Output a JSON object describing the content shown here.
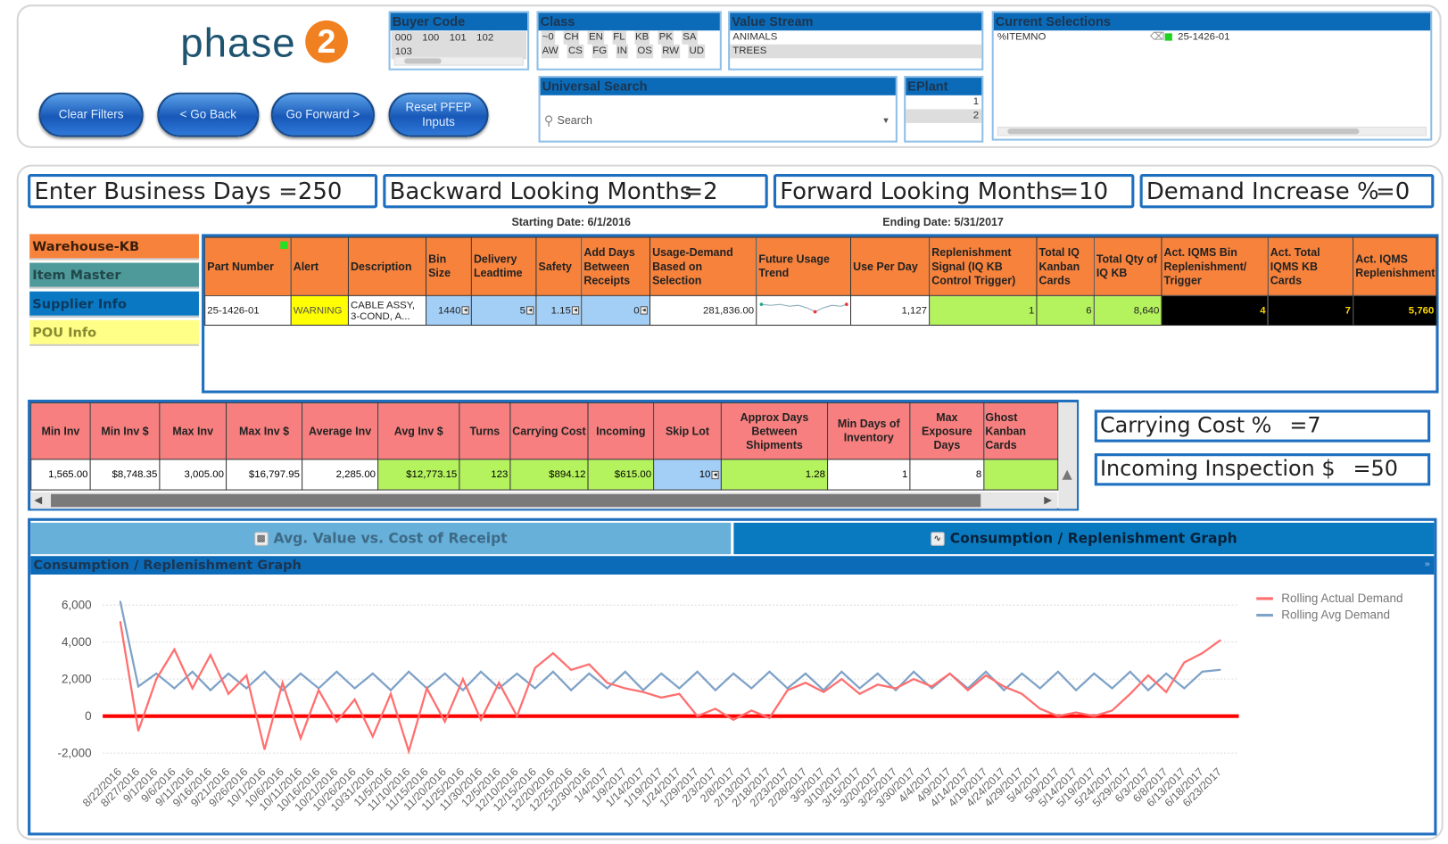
{
  "brand": {
    "logo_text": "phase",
    "logo_badge": "2",
    "accent": "#f08020"
  },
  "buttons": {
    "clear_filters": "Clear Filters",
    "go_back": "< Go Back",
    "go_forward": "Go Forward >",
    "reset_pfep": "Reset PFEP Inputs"
  },
  "filters": {
    "buyer_code": {
      "title": "Buyer Code",
      "values": [
        "000",
        "100",
        "101",
        "102",
        "103"
      ]
    },
    "class": {
      "title": "Class",
      "row1": [
        "~0",
        "CH",
        "EN",
        "FL",
        "KB",
        "PK",
        "SA"
      ],
      "row2": [
        "AW",
        "CS",
        "FG",
        "IN",
        "OS",
        "RW",
        "UD"
      ]
    },
    "value_stream": {
      "title": "Value Stream",
      "values": [
        "ANIMALS",
        "TREES"
      ]
    },
    "universal_search": {
      "title": "Universal Search",
      "placeholder": "Search"
    },
    "eplant": {
      "title": "EPlant",
      "values": [
        "1",
        "2"
      ]
    },
    "current_selections": {
      "title": "Current Selections",
      "field": "%ITEMNO",
      "value": "25-1426-01"
    }
  },
  "inputs": {
    "business_days": {
      "label": "Enter Business Days",
      "value": "=250"
    },
    "backward_months": {
      "label": "Backward Looking Months",
      "value": "=2"
    },
    "forward_months": {
      "label": "Forward Looking Months",
      "value": "=10"
    },
    "demand_increase": {
      "label": "Demand Increase %",
      "value": "=0"
    },
    "carrying_cost": {
      "label": "Carrying Cost %",
      "value": "=7"
    },
    "incoming_inspection": {
      "label": "Incoming Inspection $",
      "value": "=50"
    }
  },
  "dates": {
    "starting": "Starting Date: 6/1/2016",
    "ending": "Ending Date: 5/31/2017"
  },
  "side_tabs": [
    "Warehouse-KB",
    "Item Master",
    "Supplier Info",
    "POU Info"
  ],
  "table1": {
    "headers": [
      "Part Number",
      "Alert",
      "Description",
      "Bin Size",
      "Delivery Leadtime",
      "Safety",
      "Add Days Between Receipts",
      "Usage-Demand Based on Selection",
      "Future Usage Trend",
      "Use Per Day",
      "Replenishment Signal (IQ KB Control Trigger)",
      "Total IQ Kanban Cards",
      "Total Qty of IQ KB",
      "Act. IQMS Bin Replenishment/ Trigger",
      "Act. Total IQMS KB Cards",
      "Act. IQMS Replenishment"
    ],
    "row": [
      "25-1426-01",
      "WARNING",
      "CABLE ASSY, 3-COND, A...",
      "1440",
      "5",
      "1.15",
      "0",
      "281,836.00",
      "",
      "1,127",
      "1",
      "6",
      "8,640",
      "4",
      "7",
      "5,760"
    ]
  },
  "table2": {
    "headers": [
      "Min Inv",
      "Min Inv $",
      "Max Inv",
      "Max Inv $",
      "Average Inv",
      "Avg Inv $",
      "Turns",
      "Carrying Cost",
      "Incoming",
      "Skip Lot",
      "Approx Days Between Shipments",
      "Min Days of Inventory",
      "Max Exposure Days",
      "Ghost Kanban Cards"
    ],
    "row": [
      "1,565.00",
      "$8,748.35",
      "3,005.00",
      "$16,797.95",
      "2,285.00",
      "$12,773.15",
      "123",
      "$894.12",
      "$615.00",
      "10",
      "1.28",
      "1",
      "8",
      ""
    ]
  },
  "chart_tabs": {
    "inactive": "Avg. Value vs. Cost of Receipt",
    "active": "Consumption / Replenishment Graph"
  },
  "chart_data": {
    "type": "line",
    "title": "Consumption / Replenishment Graph",
    "ylim": [
      -2000,
      6000
    ],
    "yticks": [
      "6,000",
      "4,000",
      "2,000",
      "0",
      "-2,000"
    ],
    "ytick_values": [
      6000,
      4000,
      2000,
      0,
      -2000
    ],
    "grid": true,
    "legend_position": "right",
    "x": [
      "8/22/2016",
      "8/27/2016",
      "9/1/2016",
      "9/6/2016",
      "9/11/2016",
      "9/16/2016",
      "9/21/2016",
      "9/26/2016",
      "10/1/2016",
      "10/6/2016",
      "10/11/2016",
      "10/16/2016",
      "10/21/2016",
      "10/26/2016",
      "10/31/2016",
      "11/5/2016",
      "11/10/2016",
      "11/15/2016",
      "11/20/2016",
      "11/25/2016",
      "11/30/2016",
      "12/5/2016",
      "12/10/2016",
      "12/15/2016",
      "12/20/2016",
      "12/25/2016",
      "12/30/2016",
      "1/4/2017",
      "1/9/2017",
      "1/14/2017",
      "1/19/2017",
      "1/24/2017",
      "1/29/2017",
      "2/3/2017",
      "2/8/2017",
      "2/13/2017",
      "2/18/2017",
      "2/23/2017",
      "2/28/2017",
      "3/5/2017",
      "3/10/2017",
      "3/15/2017",
      "3/20/2017",
      "3/25/2017",
      "3/30/2017",
      "4/4/2017",
      "4/9/2017",
      "4/14/2017",
      "4/19/2017",
      "4/24/2017",
      "4/29/2017",
      "5/4/2017",
      "5/9/2017",
      "5/14/2017",
      "5/19/2017",
      "5/24/2017",
      "5/29/2017",
      "6/3/2017",
      "6/8/2017",
      "6/13/2017",
      "6/18/2017",
      "6/23/2017"
    ],
    "series": [
      {
        "name": "Rolling Actual Demand",
        "color": "#ff6f6f",
        "values": [
          5100,
          -800,
          2000,
          3600,
          1500,
          3300,
          1200,
          2200,
          -1800,
          1800,
          -1200,
          1400,
          -300,
          900,
          -1100,
          1200,
          -1900,
          1500,
          -300,
          2000,
          -200,
          1800,
          0,
          2600,
          3400,
          2500,
          2800,
          1800,
          1500,
          1300,
          1000,
          1200,
          0,
          400,
          -200,
          300,
          -100,
          1400,
          1800,
          1300,
          2000,
          1200,
          1700,
          1500,
          2000,
          1600,
          2300,
          1400,
          2200,
          1600,
          1200,
          400,
          0,
          200,
          0,
          300,
          1200,
          2200,
          1300,
          2900,
          3400,
          4100
        ]
      },
      {
        "name": "Rolling Avg Demand",
        "color": "#7fa2c8",
        "values": [
          6200,
          1600,
          2300,
          1500,
          2400,
          1400,
          2300,
          1500,
          2400,
          1400,
          2300,
          1500,
          2400,
          1500,
          2300,
          1400,
          2400,
          1500,
          2300,
          1400,
          2400,
          1500,
          2300,
          1500,
          2400,
          1400,
          2300,
          1500,
          2400,
          1400,
          2300,
          1500,
          2400,
          1400,
          2300,
          1500,
          2400,
          1500,
          2300,
          1400,
          2400,
          1500,
          2300,
          1400,
          2400,
          1500,
          2300,
          1500,
          2400,
          1400,
          2300,
          1500,
          2400,
          1400,
          2300,
          1500,
          2400,
          1400,
          2300,
          1500,
          2400,
          2500
        ]
      }
    ],
    "zero_line_color": "#ff0000"
  }
}
